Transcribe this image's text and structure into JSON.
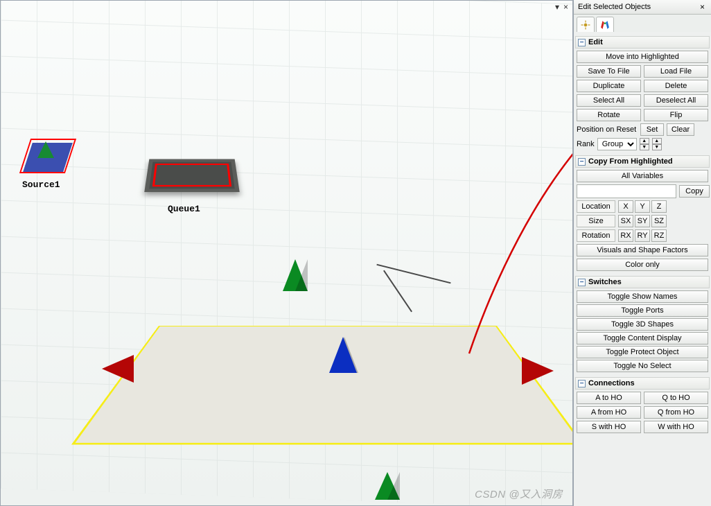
{
  "viewport": {
    "pin_glyph": "▾",
    "close_glyph": "×",
    "source_label": "Source1",
    "queue_label": "Queue1",
    "watermark": "CSDN @又入洞房"
  },
  "panel": {
    "title": "Edit Selected Objects",
    "close_glyph": "×",
    "sections": {
      "edit": {
        "header": "Edit",
        "move_into_highlighted": "Move into Highlighted",
        "save_to_file": "Save To File",
        "load_file": "Load File",
        "duplicate": "Duplicate",
        "delete": "Delete",
        "select_all": "Select All",
        "deselect_all": "Deselect All",
        "rotate": "Rotate",
        "flip": "Flip",
        "position_on_reset": "Position on Reset",
        "set": "Set",
        "clear": "Clear",
        "rank_label": "Rank",
        "rank_value": "Group",
        "up1": "▲",
        "up2": "▲",
        "down1": "▼",
        "down2": "▼"
      },
      "copy": {
        "header": "Copy From Highlighted",
        "all_variables": "All Variables",
        "copy_btn": "Copy",
        "location": "Location",
        "size": "Size",
        "rotation": "Rotation",
        "X": "X",
        "Y": "Y",
        "Z": "Z",
        "SX": "SX",
        "SY": "SY",
        "SZ": "SZ",
        "RX": "RX",
        "RY": "RY",
        "RZ": "RZ",
        "visuals": "Visuals and Shape Factors",
        "color_only": "Color only"
      },
      "switches": {
        "header": "Switches",
        "toggle_show_names": "Toggle Show Names",
        "toggle_ports": "Toggle Ports",
        "toggle_3d": "Toggle 3D Shapes",
        "toggle_content": "Toggle Content Display",
        "toggle_protect": "Toggle Protect Object",
        "toggle_no_select": "Toggle No Select"
      },
      "conn": {
        "header": "Connections",
        "a_to_ho": "A to HO",
        "q_to_ho": "Q to HO",
        "a_from_ho": "A from HO",
        "q_from_ho": "Q from HO",
        "s_with_ho": "S with HO",
        "w_with_ho": "W with HO"
      }
    }
  },
  "icons": {
    "minus": "−"
  }
}
